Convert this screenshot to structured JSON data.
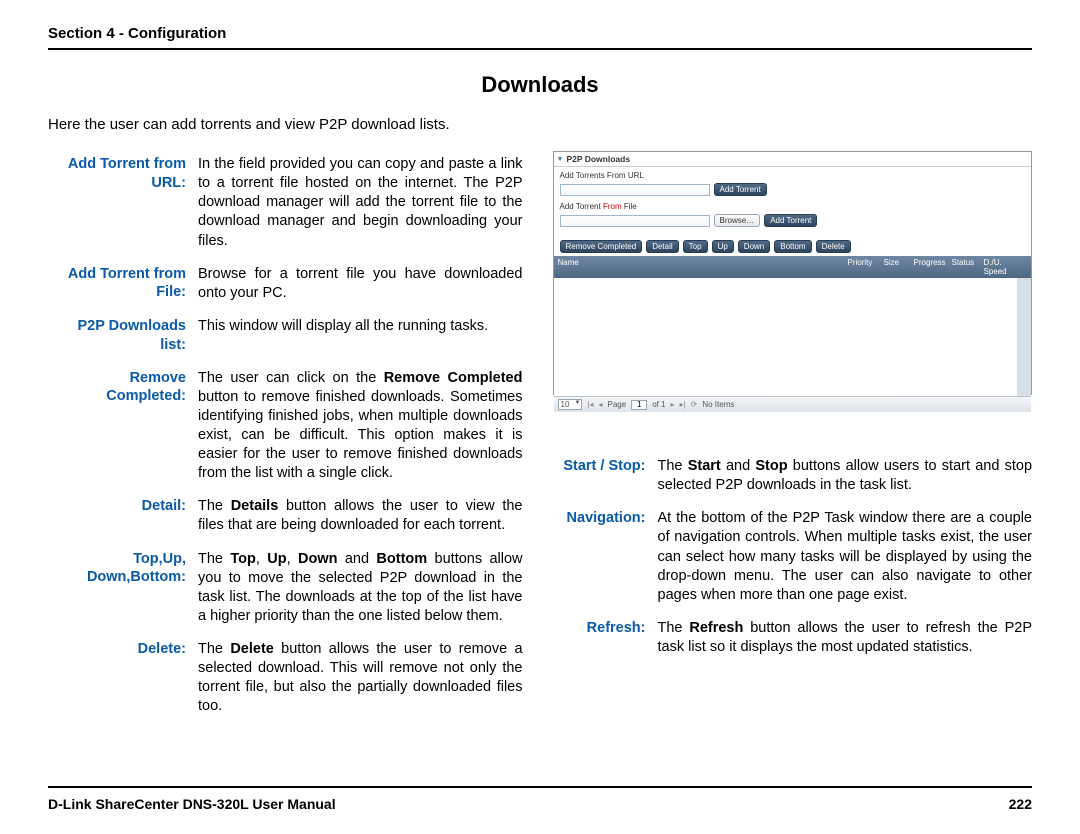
{
  "header": "Section 4 - Configuration",
  "title": "Downloads",
  "intro": "Here the user can add torrents and view P2P download lists.",
  "left_items": [
    {
      "term": "Add Torrent from URL:",
      "desc": "In the field provided you can copy and paste a link to a torrent file hosted on the internet. The P2P download manager will add the torrent file to the download manager and begin downloading your files."
    },
    {
      "term": "Add Torrent from File:",
      "desc": "Browse for a torrent file you have downloaded onto your PC."
    },
    {
      "term": "P2P Downloads list:",
      "desc": "This window will display all the running tasks."
    },
    {
      "term": "Remove Completed:",
      "desc_html": "The user can click on the <b>Remove Completed</b> button to remove finished downloads. Sometimes identifying finished jobs, when multiple downloads exist, can be difficult. This option makes it is easier for the user to remove finished downloads from the list with a single click."
    },
    {
      "term": "Detail:",
      "desc_html": "The <b>Details</b> button allows the user to view the files that are being downloaded for each torrent."
    },
    {
      "term": "Top,Up, Down,Bottom:",
      "desc_html": "The <b>Top</b>, <b>Up</b>, <b>Down</b> and <b>Bottom</b> buttons allow you to move the selected P2P download in the task list. The downloads at the top of the list have a higher priority than the one listed below them."
    },
    {
      "term": "Delete:",
      "desc_html": "The <b>Delete</b> button allows the user to remove a selected download. This will remove not only the torrent file, but also the partially downloaded files too."
    }
  ],
  "right_items": [
    {
      "term": "Start / Stop:",
      "desc_html": "The <b>Start</b> and <b>Stop</b> buttons allow users to start and stop selected P2P downloads in the task list."
    },
    {
      "term": "Navigation:",
      "desc": "At the bottom of the P2P Task window there are a couple of navigation controls. When multiple tasks exist, the user can select how many tasks will be displayed by using the drop-down menu. The user can also navigate to other pages when more than one page exist."
    },
    {
      "term": "Refresh:",
      "desc_html": "The <b>Refresh</b> button allows the user to refresh the P2P task list so it displays the most updated statistics."
    }
  ],
  "screenshot": {
    "panel_title": "P2P Downloads",
    "label_url": "Add Torrents From URL",
    "label_file_pre": "Add Torrent ",
    "label_file_red": "From",
    "label_file_post": " File",
    "btn_addtorrent": "Add Torrent",
    "btn_browse": "Browse…",
    "toolbar": [
      "Remove Completed",
      "Detail",
      "Top",
      "Up",
      "Down",
      "Bottom",
      "Delete"
    ],
    "cols": [
      "Name",
      "Priority",
      "Size",
      "Progress",
      "Status",
      "D./U. Speed"
    ],
    "pager_val": "10",
    "pager_page_text": "Page",
    "pager_page_num": "1",
    "pager_of": "of 1",
    "pager_status": "No Items"
  },
  "footer_left": "D-Link ShareCenter DNS-320L User Manual",
  "footer_right": "222"
}
